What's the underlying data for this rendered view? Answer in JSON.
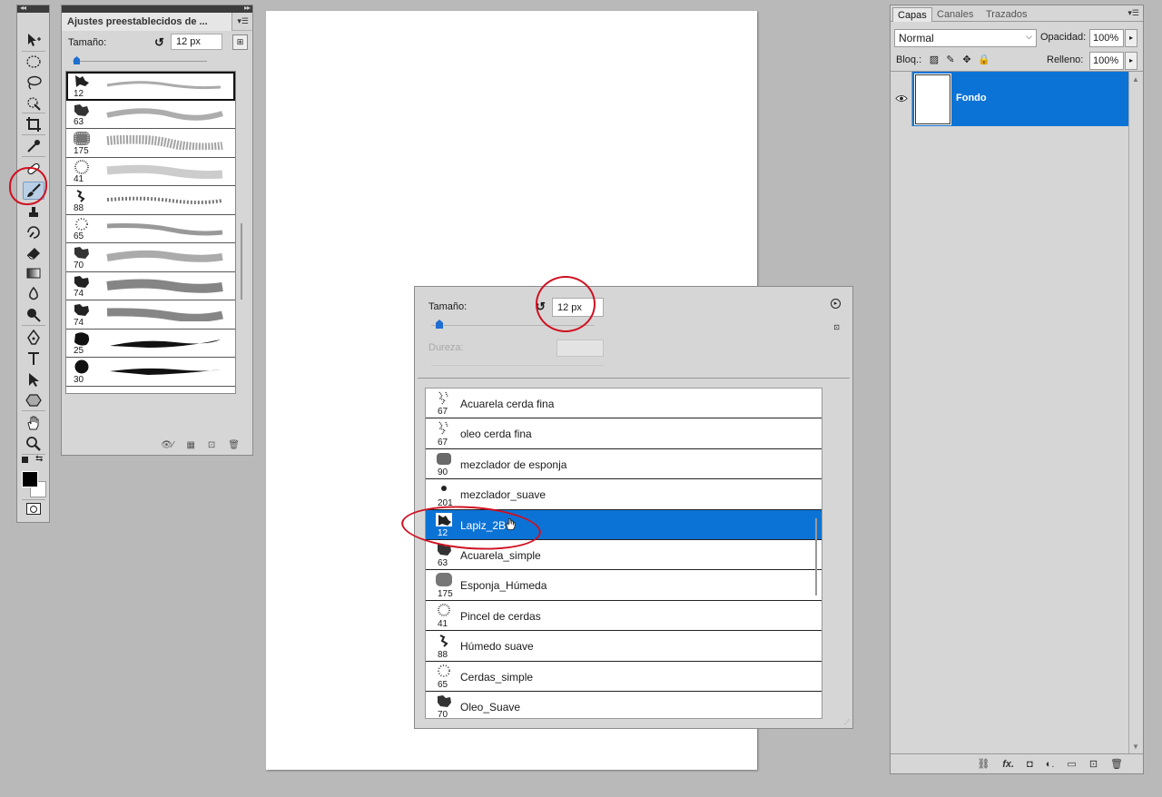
{
  "presets_panel": {
    "title": "Ajustes preestablecidos de ...",
    "size_label": "Tamaño:",
    "size_value": "12 px",
    "slider_level": 0.03,
    "brushes": [
      {
        "size": "12",
        "selected": true
      },
      {
        "size": "63"
      },
      {
        "size": "175"
      },
      {
        "size": "41"
      },
      {
        "size": "88"
      },
      {
        "size": "65"
      },
      {
        "size": "70"
      },
      {
        "size": "74"
      },
      {
        "size": "74"
      },
      {
        "size": "25"
      },
      {
        "size": "30"
      }
    ]
  },
  "brush_picker": {
    "size_label": "Tamaño:",
    "size_value": "12 px",
    "hardness_label": "Dureza:",
    "brushes": [
      {
        "size": "67",
        "name": "Acuarela cerda fina"
      },
      {
        "size": "67",
        "name": "oleo cerda fina"
      },
      {
        "size": "90",
        "name": "mezclador de esponja"
      },
      {
        "size": "201",
        "name": "mezclador_suave"
      },
      {
        "size": "12",
        "name": "Lapiz_2B",
        "selected": true
      },
      {
        "size": "63",
        "name": "Acuarela_simple"
      },
      {
        "size": "175",
        "name": "Esponja_Húmeda"
      },
      {
        "size": "41",
        "name": "Pincel de cerdas"
      },
      {
        "size": "88",
        "name": "Húmedo suave"
      },
      {
        "size": "65",
        "name": "Cerdas_simple"
      },
      {
        "size": "70",
        "name": "Oleo_Suave"
      }
    ]
  },
  "layers_panel": {
    "tabs": [
      "Capas",
      "Canales",
      "Trazados"
    ],
    "active_tab": "Capas",
    "blend_mode": "Normal",
    "opacity_label": "Opacidad:",
    "opacity_value": "100%",
    "lock_label": "Bloq.:",
    "fill_label": "Relleno:",
    "fill_value": "100%",
    "layers": [
      {
        "name": "Fondo",
        "selected": true,
        "visible": true
      }
    ],
    "footer_icons": [
      "link-icon",
      "fx-icon",
      "mask-icon",
      "adjustment-icon",
      "group-icon",
      "new-layer-icon",
      "trash-icon"
    ]
  },
  "toolbar": {
    "tools": [
      "move-tool",
      "marquee-tool",
      "lasso-tool",
      "quick-select-tool",
      "crop-tool",
      "eyedropper-tool",
      "spot-heal-tool",
      "brush-tool",
      "clone-stamp-tool",
      "history-brush-tool",
      "eraser-tool",
      "gradient-tool",
      "blur-tool",
      "dodge-tool",
      "pen-tool",
      "type-tool",
      "path-select-tool",
      "shape-tool",
      "hand-tool",
      "zoom-tool"
    ],
    "active_tool": "brush-tool",
    "foreground_color": "#000000",
    "background_color": "#ffffff"
  },
  "colors": {
    "selection": "#0c73d6",
    "annotation": "#d01020",
    "panel": "#d6d6d6",
    "workspace": "#b9b9b9"
  }
}
